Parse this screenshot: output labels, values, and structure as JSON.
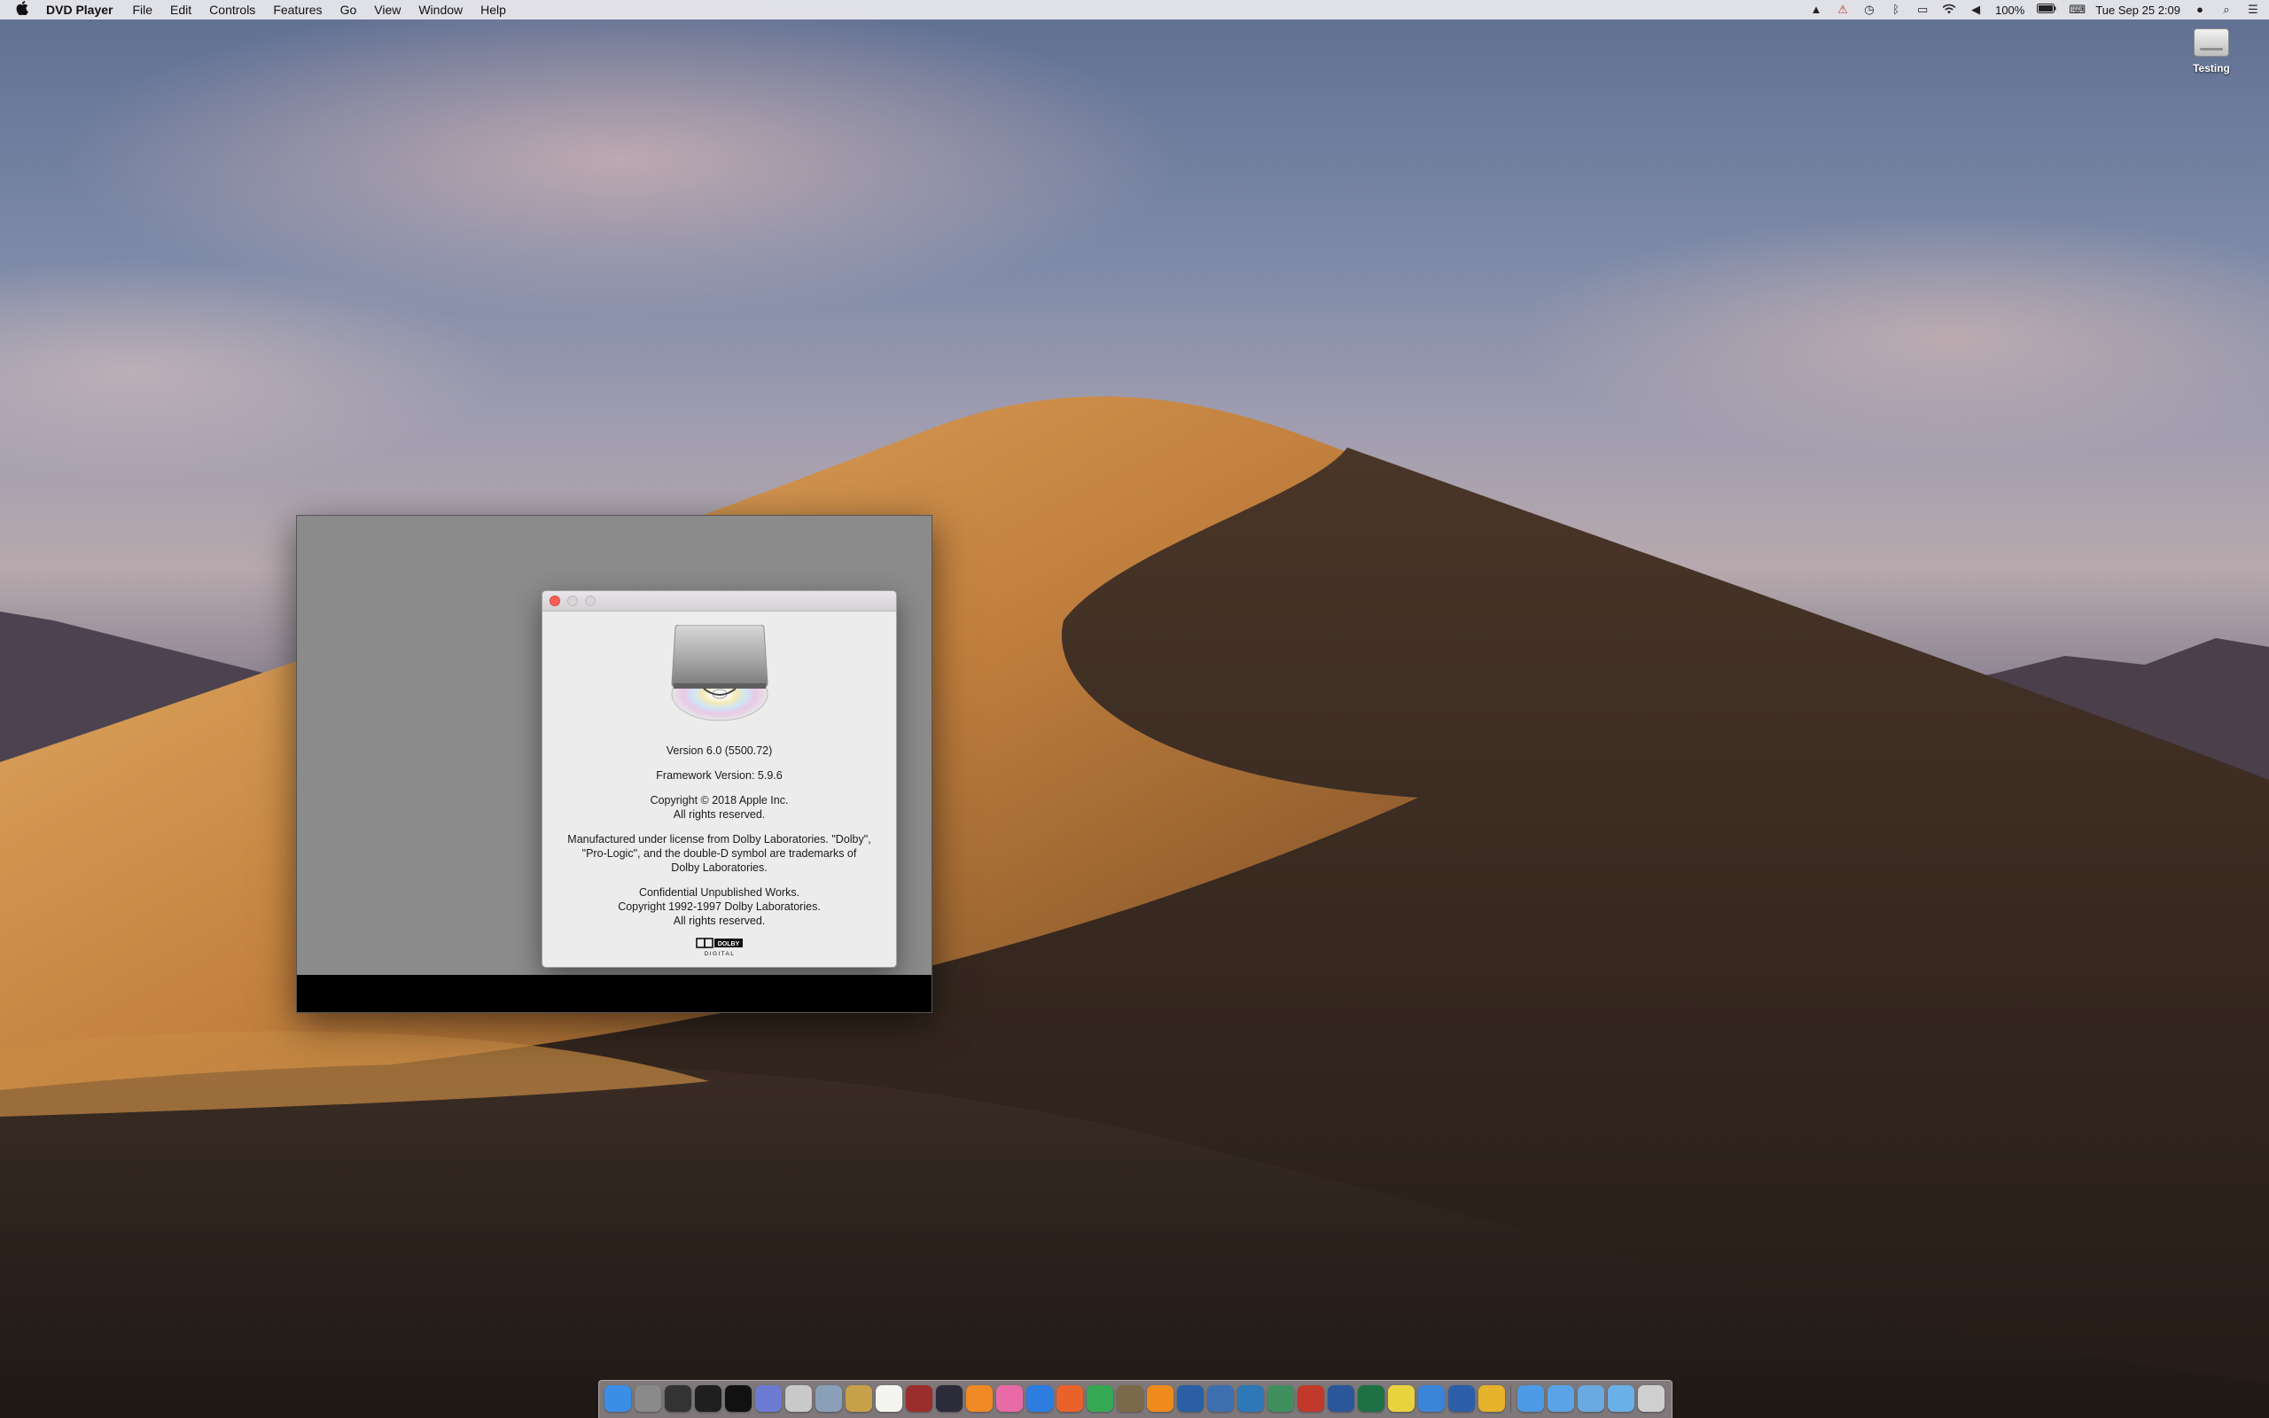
{
  "menubar": {
    "apple": "",
    "app_name": "DVD Player",
    "menus": [
      "File",
      "Edit",
      "Controls",
      "Features",
      "Go",
      "View",
      "Window",
      "Help"
    ],
    "battery": "100%",
    "datetime": "Tue Sep 25  2:09",
    "status_icons": [
      "vlc-cone-icon",
      "alert-icon",
      "time-machine-icon",
      "bluetooth-icon",
      "airplay-icon",
      "wifi-icon",
      "volume-icon",
      "battery-icon",
      "keyboard-icon",
      "user-icon",
      "spotlight-icon",
      "notification-center-icon"
    ]
  },
  "desktop": {
    "drive_label": "Testing"
  },
  "about": {
    "version": "Version 6.0 (5500.72)",
    "framework": "Framework Version: 5.9.6",
    "copyright_line1": "Copyright © 2018 Apple Inc.",
    "copyright_line2": "All rights reserved.",
    "license_line1": "Manufactured under license from Dolby Laboratories. \"Dolby\",",
    "license_line2": "\"Pro-Logic\", and the double-D symbol are trademarks of",
    "license_line3": "Dolby Laboratories.",
    "confidential_line1": "Confidential Unpublished Works.",
    "confidential_line2": "Copyright 1992-1997 Dolby Laboratories.",
    "confidential_line3": "All rights reserved.",
    "logo_line1": "DOLBY",
    "logo_line2": "DIGITAL"
  },
  "dock": {
    "apps": [
      {
        "name": "finder",
        "color": "#3a8ee6"
      },
      {
        "name": "system-preferences",
        "color": "#8a8a8a"
      },
      {
        "name": "disk-utility",
        "color": "#333333"
      },
      {
        "name": "activity-monitor",
        "color": "#1f1f1f"
      },
      {
        "name": "terminal",
        "color": "#111111"
      },
      {
        "name": "script-editor",
        "color": "#6c7bd1"
      },
      {
        "name": "dvd-player",
        "color": "#c9c9c9"
      },
      {
        "name": "preview",
        "color": "#8aa0b8"
      },
      {
        "name": "notes-book",
        "color": "#c9a04a"
      },
      {
        "name": "textedit",
        "color": "#f4f4f0"
      },
      {
        "name": "photo-booth",
        "color": "#9b2d2d"
      },
      {
        "name": "quicktime",
        "color": "#2b2b3a"
      },
      {
        "name": "ibooks",
        "color": "#f08a24"
      },
      {
        "name": "itunes",
        "color": "#e86aa6"
      },
      {
        "name": "safari",
        "color": "#2d7de0"
      },
      {
        "name": "firefox",
        "color": "#e8622a"
      },
      {
        "name": "chrome",
        "color": "#34a853"
      },
      {
        "name": "gimp",
        "color": "#7a6a4a"
      },
      {
        "name": "vlc",
        "color": "#ef8a1d"
      },
      {
        "name": "quicktime-x",
        "color": "#2a5fa5"
      },
      {
        "name": "screen-sharing",
        "color": "#3d6fb0"
      },
      {
        "name": "network-utility",
        "color": "#2e78b7"
      },
      {
        "name": "world-browser",
        "color": "#3f8f5f"
      },
      {
        "name": "presenter",
        "color": "#c0392b"
      },
      {
        "name": "word",
        "color": "#2b579a"
      },
      {
        "name": "excel-x",
        "color": "#1e7145"
      },
      {
        "name": "stickies",
        "color": "#e9d33d"
      },
      {
        "name": "keynote",
        "color": "#3c84d8"
      },
      {
        "name": "directory",
        "color": "#2d5fa8"
      },
      {
        "name": "photos-pencil",
        "color": "#e6b22a"
      },
      {
        "name": "applications-folder",
        "color": "#4d9be6"
      },
      {
        "name": "documents-folder",
        "color": "#5aa3e6"
      },
      {
        "name": "downloads-folder",
        "color": "#6aaae0"
      },
      {
        "name": "desktop-folder",
        "color": "#6ab0e8"
      },
      {
        "name": "trash",
        "color": "#cfcfcf"
      }
    ]
  }
}
